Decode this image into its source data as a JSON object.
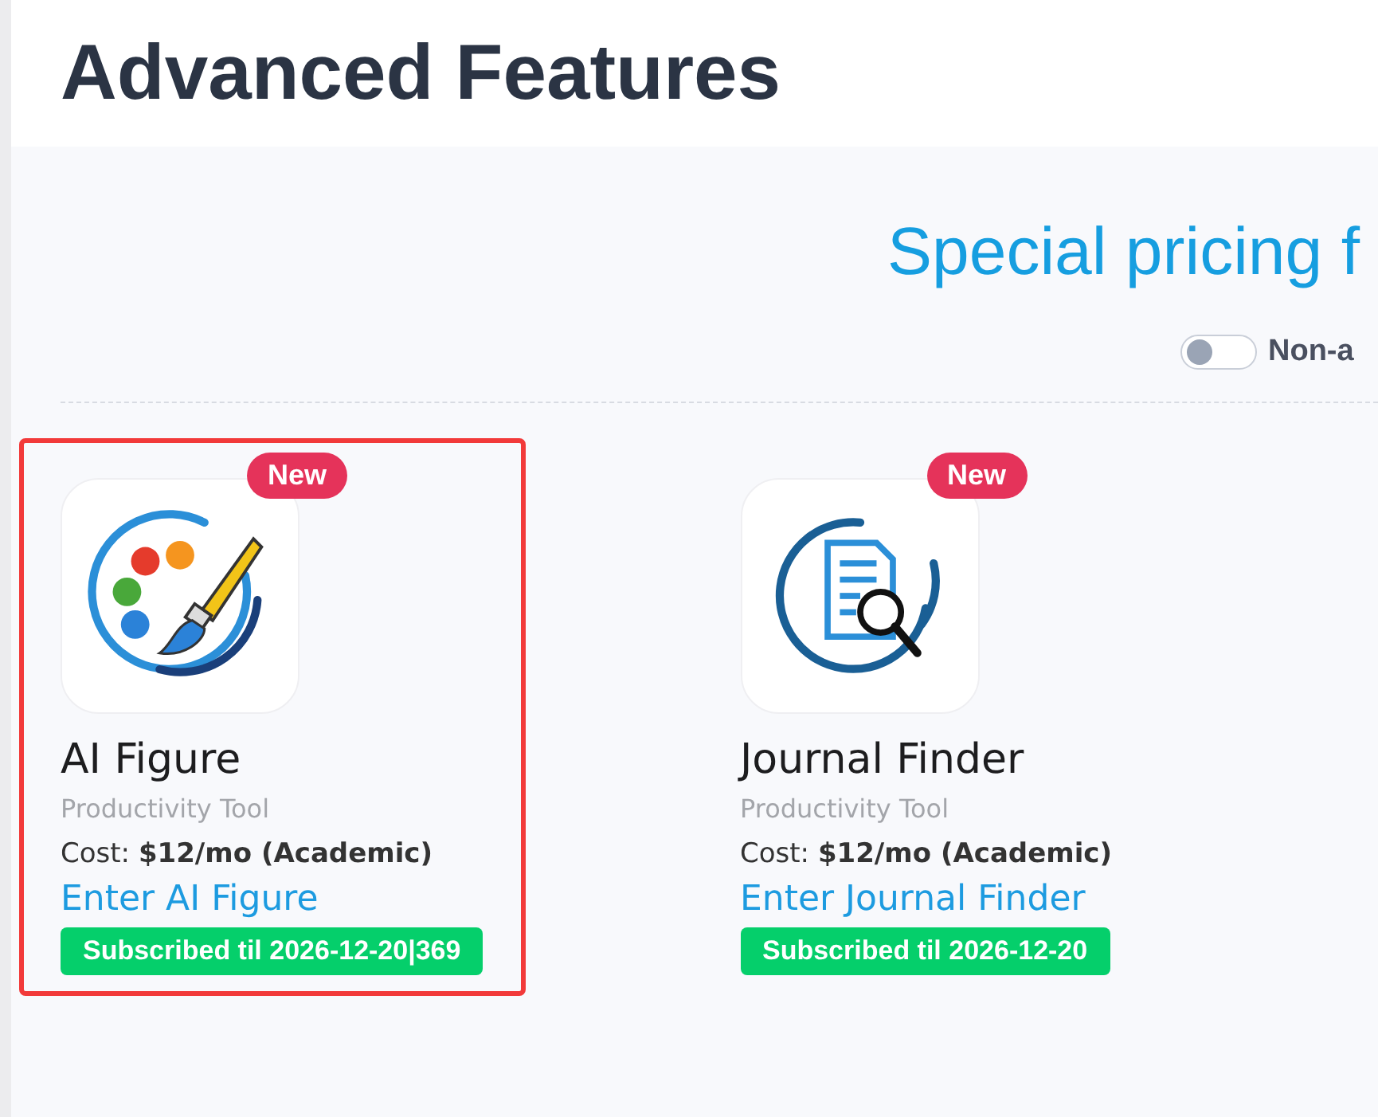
{
  "header": {
    "title": "Advanced Features"
  },
  "pricing": {
    "title": "Special pricing f",
    "toggle": {
      "label": "Non-a",
      "on": false
    }
  },
  "cards": [
    {
      "name": "AI Figure",
      "badge": "New",
      "kind": "palette",
      "category": "Productivity Tool",
      "cost": "Cost: **$12/mo (Academic)**",
      "link": "Enter AI Figure",
      "status": "Subscribed til 2026-12-20|369",
      "highlighted": true
    },
    {
      "name": "Journal Finder",
      "badge": "New",
      "kind": "doc-search",
      "category": "Productivity Tool",
      "cost": "Cost: **$12/mo (Academic)**",
      "link": "Enter Journal Finder",
      "status": "Subscribed til 2026-12-20",
      "highlighted": false
    }
  ]
}
